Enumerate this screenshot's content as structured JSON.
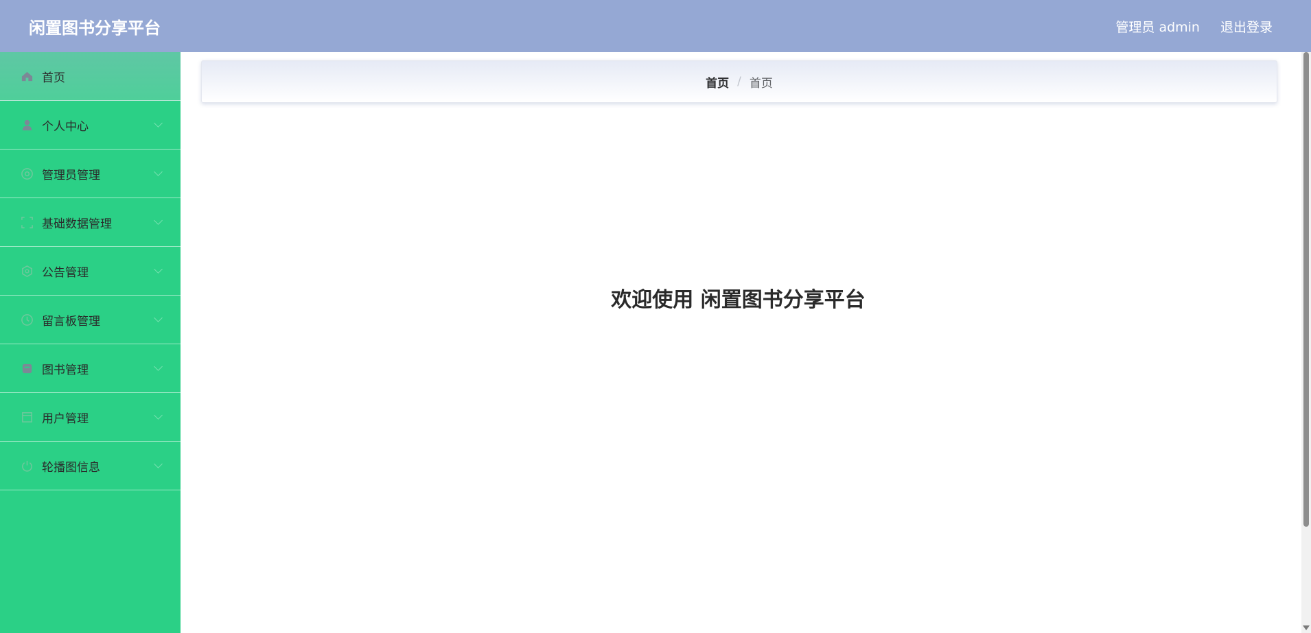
{
  "header": {
    "title": "闲置图书分享平台",
    "user_label": "管理员 admin",
    "logout_label": "退出登录"
  },
  "sidebar": {
    "items": [
      {
        "label": "首页",
        "icon": "home-icon",
        "active": true
      },
      {
        "label": "个人中心",
        "icon": "user-icon"
      },
      {
        "label": "管理员管理",
        "icon": "admin-icon"
      },
      {
        "label": "基础数据管理",
        "icon": "data-icon"
      },
      {
        "label": "公告管理",
        "icon": "notice-icon"
      },
      {
        "label": "留言板管理",
        "icon": "message-icon"
      },
      {
        "label": "图书管理",
        "icon": "book-icon"
      },
      {
        "label": "用户管理",
        "icon": "users-icon"
      },
      {
        "label": "轮播图信息",
        "icon": "carousel-icon"
      }
    ]
  },
  "breadcrumb": {
    "items": [
      "首页",
      "首页"
    ],
    "separator": "/"
  },
  "main": {
    "welcome_text": "欢迎使用 闲置图书分享平台"
  },
  "colors": {
    "header_bg": "#95a8d4",
    "sidebar_bg": "#2bd086",
    "icon_color": "#7a8a9a"
  }
}
